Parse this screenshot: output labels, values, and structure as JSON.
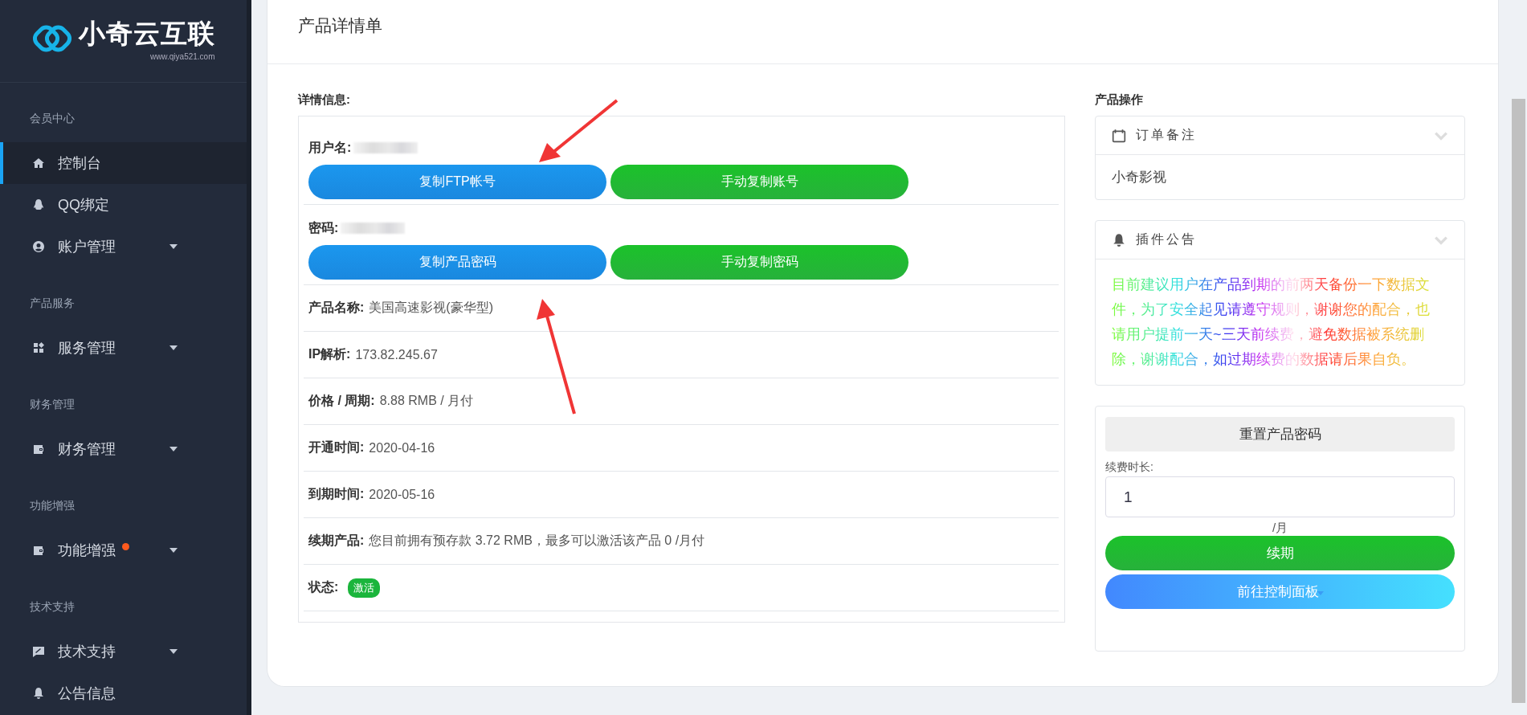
{
  "logo": {
    "name": "小奇云互联",
    "url": "www.qiya521.com"
  },
  "sidebar": {
    "sections": [
      {
        "heading": "会员中心",
        "items": [
          {
            "label": "控制台",
            "selected": true,
            "expandable": false,
            "badge": false
          },
          {
            "label": "QQ绑定",
            "selected": false,
            "expandable": false,
            "badge": false
          },
          {
            "label": "账户管理",
            "selected": false,
            "expandable": true,
            "badge": false
          }
        ]
      },
      {
        "heading": "产品服务",
        "items": [
          {
            "label": "服务管理",
            "selected": false,
            "expandable": true,
            "badge": false
          }
        ]
      },
      {
        "heading": "财务管理",
        "items": [
          {
            "label": "财务管理",
            "selected": false,
            "expandable": true,
            "badge": false
          }
        ]
      },
      {
        "heading": "功能增强",
        "items": [
          {
            "label": "功能增强",
            "selected": false,
            "expandable": true,
            "badge": true
          }
        ]
      },
      {
        "heading": "技术支持",
        "items": [
          {
            "label": "技术支持",
            "selected": false,
            "expandable": true,
            "badge": false
          },
          {
            "label": "公告信息",
            "selected": false,
            "expandable": false,
            "badge": false
          }
        ]
      }
    ]
  },
  "page_title": "产品详情单",
  "details": {
    "heading": "详情信息:",
    "credentials": [
      {
        "label": "用户名:",
        "buttons": [
          {
            "label": "复制FTP帐号",
            "kind": "primary"
          },
          {
            "label": "手动复制账号",
            "kind": "success"
          }
        ]
      },
      {
        "label": "密码:",
        "buttons": [
          {
            "label": "复制产品密码",
            "kind": "primary"
          },
          {
            "label": "手动复制密码",
            "kind": "success"
          }
        ]
      }
    ],
    "fields": [
      {
        "label": "产品名称:",
        "value": "美国高速影视(豪华型)"
      },
      {
        "label": "IP解析:",
        "value": "173.82.245.67"
      },
      {
        "label": "价格 / 周期:",
        "value": "8.88 RMB / 月付"
      },
      {
        "label": "开通时间:",
        "value": "2020-04-16"
      },
      {
        "label": "到期时间:",
        "value": "2020-05-16"
      },
      {
        "label": "续期产品:",
        "value": "您目前拥有预存款 3.72 RMB，最多可以激活该产品 0 /月付"
      },
      {
        "label": "状态:",
        "status": "激活"
      }
    ]
  },
  "operations": {
    "heading": "产品操作",
    "order_note": {
      "title": "订单备注",
      "text": "小奇影视"
    },
    "notice": {
      "title": "插件公告",
      "text": "目前建议用户在产品到期的前两天备份一下数据文件，为了安全起见请遵守规则，谢谢您的配合，也请用户提前一天~三天前续费，避免数据被系统删除，谢谢配合，如过期续费的数据请后果自负。"
    },
    "renewal": {
      "reset_button": "重置产品密码",
      "duration_label": "续费时长:",
      "duration_value": "1",
      "unit": "/月",
      "renew_button": "续期",
      "panel_button": "前往控制面板"
    }
  }
}
